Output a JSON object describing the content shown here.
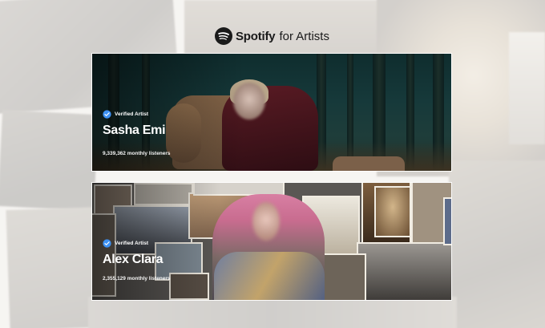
{
  "brand": {
    "wordmark": "Spotify",
    "sub": "for Artists",
    "logo_icon": "spotify-logo-icon"
  },
  "artists": [
    {
      "badge_label": "Verified Artist",
      "name": "Sasha Emi",
      "listeners": "9,339,362 monthly listeners"
    },
    {
      "badge_label": "Verified Artist",
      "name": "Alex Clara",
      "listeners": "2,355,129 monthly listeners"
    }
  ],
  "colors": {
    "verified_badge": "#3d91f4",
    "text": "#1a1a1a"
  }
}
